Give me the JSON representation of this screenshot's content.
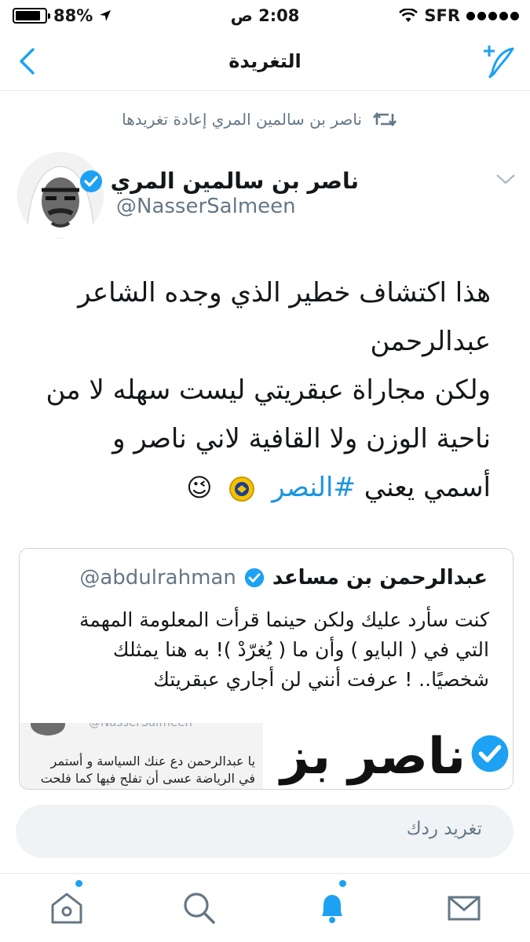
{
  "status_bar": {
    "battery": "88%",
    "time": "2:08 ص",
    "carrier": "SFR"
  },
  "nav": {
    "title": "التغريدة"
  },
  "retweet": {
    "text": "ناصر بن سالمين المري إعادة تغريدها"
  },
  "author": {
    "name": "ناصر بن سالمين المري",
    "handle": "@NasserSalmeen"
  },
  "tweet": {
    "lines": [
      "هذا اكتشاف خطير الذي وجده الشاعر",
      "عبدالرحمن",
      "ولكن مجاراة عبقريتي ليست سهله لا من",
      "ناحية الوزن ولا القافية لاني ناصر و"
    ],
    "last_prefix": "أسمي يعني",
    "hashtag": "#النصر",
    "emoji": "😉"
  },
  "quote": {
    "name": "عبدالرحمن بن مساعد",
    "handle": "@abdulrahman",
    "lines": [
      "كنت سأرد عليك ولكن حينما قرأت المعلومة المهمة",
      "التي في ( البايو ) وأن ما ( يُغرّدْ )! به هنا يمثلك",
      "شخصيًا.. ! عرفت أنني لن أجاري عبقريتك"
    ],
    "media_left_handle": "@NasserSalmeen",
    "media_left_lines": [
      "يا عبدالرحمن دع عنك السياسة و أستمر",
      "في الرياضة عسى أن تفلح فيها كما فلحت"
    ],
    "media_right_text": "ناصر بز"
  },
  "reply": {
    "placeholder": "تغريد ردك"
  },
  "colors": {
    "accent": "#1da1f2",
    "hashtag": "#1b95e0",
    "muted": "#657786"
  }
}
